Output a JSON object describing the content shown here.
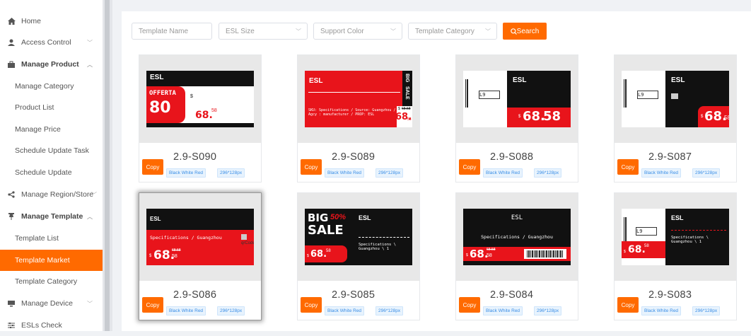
{
  "sidebar": {
    "items": [
      {
        "label": "Home",
        "icon": "home-icon"
      },
      {
        "label": "Access Control",
        "icon": "user-icon"
      },
      {
        "label": "Manage Product",
        "icon": "bag-icon"
      },
      {
        "label": "Manage Category"
      },
      {
        "label": "Product List"
      },
      {
        "label": "Manage Price"
      },
      {
        "label": "Schedule Update Task"
      },
      {
        "label": "Schedule Update"
      },
      {
        "label": "Manage Region/Store",
        "icon": "share-icon"
      },
      {
        "label": "Manage Template",
        "icon": "pin-icon"
      },
      {
        "label": "Template List"
      },
      {
        "label": "Template Market"
      },
      {
        "label": "Template Category"
      },
      {
        "label": "Manage Device",
        "icon": "monitor-icon"
      },
      {
        "label": "ESLs Check",
        "icon": "sliders-icon"
      }
    ],
    "active": "Template Market"
  },
  "filters": {
    "template_name_placeholder": "Template Name",
    "esl_size_placeholder": "ESL Size",
    "support_color_placeholder": "Support Color",
    "template_category_placeholder": "Template Category",
    "search_label": "Search"
  },
  "common": {
    "copy_label": "Copy",
    "color_badge": "Black White Red",
    "size_badge": "296*128px",
    "esl": "ESL",
    "price_int": "68.",
    "price_dec": "58",
    "dollar": "$"
  },
  "templates": [
    {
      "name": "2.9-S090",
      "offerta": "OFFERTA",
      "pct": "80"
    },
    {
      "name": "2.9-S089",
      "sku": "SKU: Specifications / Source: Guangzhou / Agcy : manufacturer / PROP: ESL",
      "big": "BIG",
      "sale": "SALE",
      "old": "68.58"
    },
    {
      "name": "2.9-S088"
    },
    {
      "name": "2.9-S087"
    },
    {
      "name": "2.9-S086",
      "spec": "Specifications / Guangzhou",
      "old": "68.58",
      "qr": "qrCode"
    },
    {
      "name": "2.9-S085",
      "big": "BIG",
      "pct": "50%",
      "sale": "SALE",
      "spec": "Specifications \\ Guangzhou \\ 1"
    },
    {
      "name": "2.9-S084",
      "spec": "Specifications / Guangzhou",
      "old": "68.58"
    },
    {
      "name": "2.9-S083",
      "spec": "Specifications \\ Guangzhou \\ 1"
    }
  ],
  "colors": {
    "accent": "#ff6a00",
    "tag_red": "#e8141b",
    "tag_black": "#111111"
  }
}
